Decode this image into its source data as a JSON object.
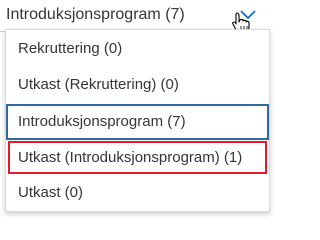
{
  "select": {
    "value": "Introduksjonsprogram (7)"
  },
  "options": [
    {
      "label": "Rekruttering (0)"
    },
    {
      "label": "Utkast (Rekruttering) (0)"
    },
    {
      "label": "Introduksjonsprogram (7)"
    },
    {
      "label": "Utkast (Introduksjonsprogram) (1)"
    },
    {
      "label": "Utkast (0)"
    }
  ],
  "colors": {
    "text": "#32363a",
    "selected_border": "#2f6aa5",
    "annotation_border": "#e11a2c",
    "arrow": "#0a6ed1"
  },
  "icons": {
    "dropdown_arrow": "chevron-down-icon",
    "cursor": "hand-pointer-icon"
  }
}
